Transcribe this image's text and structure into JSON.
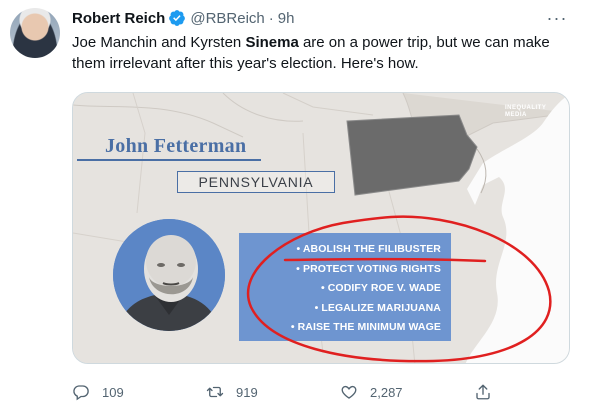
{
  "tweet": {
    "author_name": "Robert Reich",
    "handle": "@RBReich",
    "separator": "·",
    "time": "9h",
    "text_before": "Joe Manchin and Kyrsten ",
    "text_bold": "Sinema",
    "text_after": " are on a power trip, but we can make them irrelevant after this year's election. Here's how.",
    "more_label": "···"
  },
  "media": {
    "watermark_line1": "INEQUALITY",
    "watermark_line2": "MEDIA",
    "candidate_name": "John Fetterman",
    "state": "PENNSYLVANIA",
    "policies": [
      "• ABOLISH THE FILIBUSTER",
      "• PROTECT VOTING RIGHTS",
      "• CODIFY ROE V. WADE",
      "• LEGALIZE MARIJUANA",
      "• RAISE THE MINIMUM WAGE"
    ],
    "colors": {
      "accent_blue": "#4a6fa5",
      "policy_box": "#6e95d0",
      "annotation_red": "#e02020",
      "highlight_state": "#6b6b6b"
    }
  },
  "actions": {
    "reply_count": "109",
    "retweet_count": "919",
    "like_count": "2,287",
    "icons": [
      "reply-icon",
      "retweet-icon",
      "like-icon",
      "share-icon"
    ]
  }
}
